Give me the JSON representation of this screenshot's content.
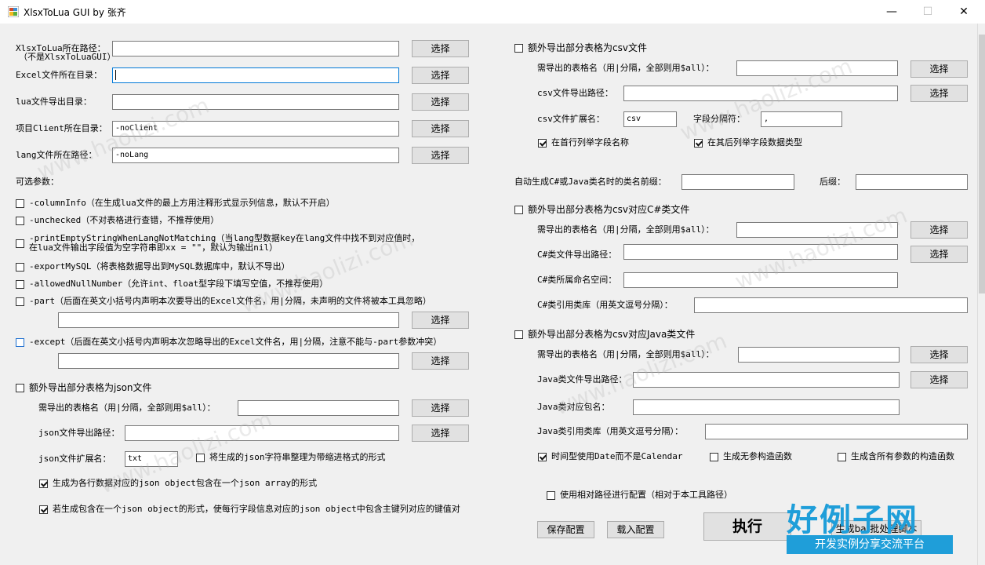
{
  "window": {
    "title": "XlsxToLua GUI by 张齐"
  },
  "left": {
    "xlsx_path_label": "XlsxToLua所在路径：",
    "xlsx_path_note": "（不是XlsxToLuaGUI）",
    "excel_dir_label": "Excel文件所在目录：",
    "lua_dir_label": "lua文件导出目录：",
    "client_dir_label": "项目Client所在目录：",
    "client_dir_value": "-noClient",
    "lang_path_label": "lang文件所在路径：",
    "lang_path_value": "-noLang",
    "optional_label": "可选参数：",
    "opt_columninfo": "-columnInfo（在生成lua文件的最上方用注释形式显示列信息，默认不开启）",
    "opt_unchecked": "-unchecked（不对表格进行查错，不推荐使用）",
    "opt_print_empty_1": "-printEmptyStringWhenLangNotMatching（当lang型数据key在lang文件中找不到对应值时，",
    "opt_print_empty_2": "在lua文件输出字段值为空字符串即xx = \"\"，默认为输出nil）",
    "opt_export_mysql": "-exportMySQL（将表格数据导出到MySQL数据库中，默认不导出）",
    "opt_allowed_null": "-allowedNullNumber（允许int、float型字段下填写空值，不推荐使用）",
    "opt_part": "-part（后面在英文小括号内声明本次要导出的Excel文件名，用|分隔，未声明的文件将被本工具忽略）",
    "opt_except": "-except（后面在英文小括号内声明本次忽略导出的Excel文件名，用|分隔，注意不能与-part参数冲突）",
    "json_export": "额外导出部分表格为json文件",
    "json_tables_label": "需导出的表格名（用|分隔，全部则用$all）：",
    "json_dir_label": "json文件导出路径：",
    "json_ext_label": "json文件扩展名：",
    "json_ext_value": "txt",
    "json_indent": "将生成的json字符串整理为带缩进格式的形式",
    "json_array": "生成为各行数据对应的json object包含在一个json array的形式",
    "json_object": "若生成包含在一个json object的形式，使每行字段信息对应的json object中包含主键列对应的键值对"
  },
  "right": {
    "csv_export": "额外导出部分表格为csv文件",
    "csv_tables_label": "需导出的表格名（用|分隔，全部则用$all）：",
    "csv_dir_label": "csv文件导出路径：",
    "csv_ext_label": "csv文件扩展名：",
    "csv_ext_value": "csv",
    "csv_sep_label": "字段分隔符：",
    "csv_sep_value": ",",
    "csv_first_row": "在首行列举字段名称",
    "csv_type_row": "在其后列举字段数据类型",
    "class_prefix_label": "自动生成C#或Java类名时的类名前缀：",
    "class_suffix_label": "后缀：",
    "cs_export": "额外导出部分表格为csv对应C#类文件",
    "cs_tables_label": "需导出的表格名（用|分隔，全部则用$all）：",
    "cs_dir_label": "C#类文件导出路径：",
    "cs_namespace_label": "C#类所属命名空间：",
    "cs_using_label": "C#类引用类库（用英文逗号分隔）：",
    "java_export": "额外导出部分表格为csv对应Java类文件",
    "java_tables_label": "需导出的表格名（用|分隔，全部则用$all）：",
    "java_dir_label": "Java类文件导出路径：",
    "java_package_label": "Java类对应包名：",
    "java_import_label": "Java类引用类库（用英文逗号分隔）：",
    "java_date": "时间型使用Date而不是Calendar",
    "java_noarg": "生成无参构造函数",
    "java_allarg": "生成含所有参数的构造函数",
    "relative_path": "使用相对路径进行配置（相对于本工具路径）"
  },
  "buttons": {
    "choose": "选择",
    "save_config": "保存配置",
    "load_config": "载入配置",
    "execute": "执行",
    "gen_bat": "生成bat批处理脚本"
  },
  "watermark": {
    "text": "www.haolizi.com",
    "logo_big": "好例子网",
    "logo_sub": "开发实例分享交流平台"
  },
  "colors": {
    "focus_border": "#0078d7",
    "logo_blue": "#1f9ed9"
  }
}
